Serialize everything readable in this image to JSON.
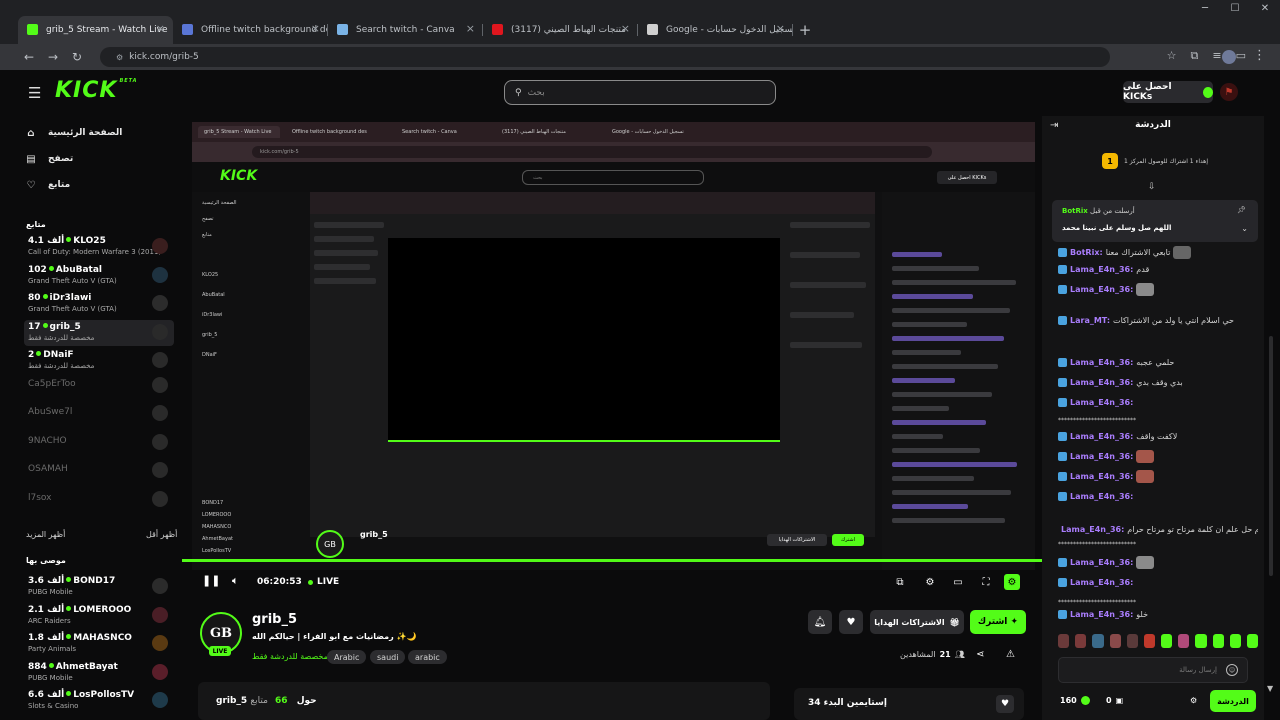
{
  "browser": {
    "tabs": [
      {
        "title": "grib_5 Stream - Watch Live",
        "favicon_color": "#53fc18",
        "active": true
      },
      {
        "title": "Offline twitch background des",
        "favicon_color": "#5a76d6",
        "active": false
      },
      {
        "title": "Search twitch - Canva",
        "favicon_color": "#7ab3e6",
        "active": false
      },
      {
        "title": "متنجات الهباط الصيني (3117)",
        "favicon_color": "#e0161e",
        "active": false
      },
      {
        "title": "Google - تسجيل الدخول حسابات",
        "favicon_color": "#cfcfcf",
        "active": false
      }
    ],
    "url": "kick.com/grib-5"
  },
  "header": {
    "logo": "KICK",
    "logo_tm": "BETA",
    "search_placeholder": "بحث",
    "get_kicks_label": "احصل على KICKs"
  },
  "sidebar": {
    "nav": [
      {
        "label": "الصفحة الرئيسية",
        "icon": "home-icon"
      },
      {
        "label": "تصفح",
        "icon": "browse-icon"
      },
      {
        "label": "متابع",
        "icon": "heart-icon"
      }
    ],
    "following_heading": "متابع",
    "following": [
      {
        "name": "KLO25",
        "viewers": "4.1 ألف",
        "category": "Call of Duty: Modern Warfare 3 (2011)",
        "live": true
      },
      {
        "name": "AbuBatal",
        "viewers": "102",
        "category": "Grand Theft Auto V (GTA)",
        "live": true
      },
      {
        "name": "iDr3lawi",
        "viewers": "80",
        "category": "Grand Theft Auto V (GTA)",
        "live": true
      },
      {
        "name": "grib_5",
        "viewers": "17",
        "category": "مخصصة للدردشة فقط",
        "live": true,
        "selected": true
      },
      {
        "name": "DNaiF",
        "viewers": "2",
        "category": "مخصصة للدردشة فقط",
        "live": true
      },
      {
        "name": "Ca5pErToo",
        "live": false
      },
      {
        "name": "AbuSwe7l",
        "live": false
      },
      {
        "name": "9NACHO",
        "live": false
      },
      {
        "name": "OSAMAH",
        "live": false
      },
      {
        "name": "l7sox",
        "live": false
      }
    ],
    "show_more": "أظهر المزيد",
    "show_less": "أظهر أقل",
    "recommended_heading": "موصى بها",
    "recommended": [
      {
        "name": "BOND17",
        "viewers": "3.6 ألف",
        "category": "PUBG Mobile"
      },
      {
        "name": "LOMEROOO",
        "viewers": "2.1 ألف",
        "category": "ARC Raiders"
      },
      {
        "name": "MAHASNCO",
        "viewers": "1.8 ألف",
        "category": "Party Animals"
      },
      {
        "name": "AhmetBayat",
        "viewers": "884",
        "category": "PUBG Mobile"
      },
      {
        "name": "LosPollosTV",
        "viewers": "6.6 ألف",
        "category": "Slots & Casino"
      }
    ]
  },
  "player": {
    "timecode": "06:20:53",
    "live_label": "LIVE",
    "progress": 1.0
  },
  "streamer": {
    "name": "grib_5",
    "avatar_text": "GB",
    "live_badge": "LIVE",
    "title": "رمضانيات مع ابو الفراء | حيالكم الله ✨🌙",
    "category": "مخصصة للدردشة فقط",
    "tags": [
      "Arabic",
      "saudi",
      "arabic"
    ],
    "subscribe_label": "اشترك",
    "gift_label": "الاشتراكات الهدايا",
    "viewers_label": "المشاهدين",
    "viewers_count": "21",
    "about_name": "grib_5 حول",
    "followers_count": "66",
    "followers_label": "متابع",
    "clips_label": "إستايمين البدء 34"
  },
  "chat": {
    "title": "الدردشة",
    "leaderboard_rank": "1",
    "leaderboard_text": "إهداء 1 اشتراك للوصول المركز 1",
    "pinned_user": "BotRix",
    "pinned_prefix": "أرسلت من قبل",
    "pinned_message": "اللهم صل وسلم على نبينا محمد",
    "messages": [
      {
        "user": "BotRix:",
        "text": "تابعي الاشتراك معنا",
        "emote": "#666"
      },
      {
        "user": "Lama_E4n_36:",
        "text": "قدم",
        "emote": ""
      },
      {
        "user": "Lama_E4n_36:",
        "text": "",
        "emote": "#8a8a8a"
      },
      {
        "user": "Lara_MT:",
        "text": "حي اسلام انتي يا ولد من الاشتراكات",
        "emote": ""
      },
      {
        "user": "Lama_E4n_36:",
        "text": "حلمي عجبه",
        "emote": ""
      },
      {
        "user": "Lama_E4n_36:",
        "text": "بدي وقف بدي",
        "emote": ""
      },
      {
        "user": "Lama_E4n_36:",
        "text": "",
        "emote": ""
      },
      {
        "user": "Lama_E4n_36:",
        "text": "لاكفت واقف",
        "emote": ""
      },
      {
        "user": "Lama_E4n_36:",
        "text": "",
        "emote": "#a4564a"
      },
      {
        "user": "Lama_E4n_36:",
        "text": "",
        "emote": "#a4564a"
      },
      {
        "user": "Lama_E4n_36:",
        "text": "",
        "emote": ""
      },
      {
        "user": "Lama_E4n_36:",
        "text": "حسام حل علم ان كلمة مرتاح تو مرتاح حرام",
        "emote": ""
      },
      {
        "user": "Lama_E4n_36:",
        "text": "",
        "emote": "#8a8a8a"
      },
      {
        "user": "Lama_E4n_36:",
        "text": "",
        "emote": ""
      },
      {
        "user": "Lama_E4n_36:",
        "text": "خلو",
        "emote": ""
      }
    ],
    "stars": "**************************",
    "input_placeholder": "إرسال رسالة",
    "kicks_count": "160",
    "points_count": "0",
    "send_label": "الدردشة"
  }
}
